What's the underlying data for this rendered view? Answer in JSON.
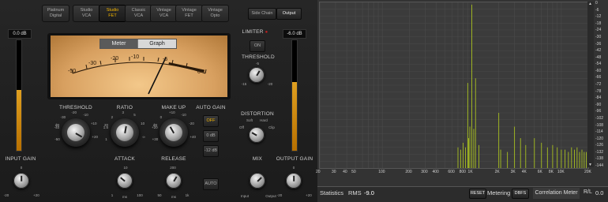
{
  "presets": [
    {
      "label": "Platinum\nDigital",
      "active": false
    },
    {
      "label": "Studio\nVCA",
      "active": false
    },
    {
      "label": "Studio\nFET",
      "active": true
    },
    {
      "label": "Classic\nVCA",
      "active": false
    },
    {
      "label": "Vintage\nVCA",
      "active": false
    },
    {
      "label": "Vintage\nFET",
      "active": false
    },
    {
      "label": "Vintage\nOpto",
      "active": false
    }
  ],
  "tabs": {
    "side_chain": "Side Chain",
    "output": "Output"
  },
  "input_meter": {
    "readout": "0.0 dB",
    "level": 0.55
  },
  "output_meter": {
    "readout": "-6.0 dB",
    "level": 0.62
  },
  "meter": {
    "tab_meter": "Meter",
    "tab_graph": "Graph",
    "scale": [
      "-50",
      "-30",
      "-20",
      "-10",
      "-5",
      "0"
    ]
  },
  "labels": {
    "threshold": "THRESHOLD",
    "ratio": "RATIO",
    "make_up": "MAKE UP",
    "auto_gain": "AUTO GAIN",
    "input_gain": "INPUT GAIN",
    "attack": "ATTACK",
    "release": "RELEASE",
    "limiter": "LIMITER",
    "limiter_threshold": "THRESHOLD",
    "distortion": "DISTORTION",
    "mix": "MIX",
    "output_gain": "OUTPUT GAIN",
    "soft": "Soft",
    "hard": "Hard",
    "off": "Off",
    "clip": "Clip",
    "input": "Input",
    "output": "Output",
    "db": "dB",
    "ms": "ms"
  },
  "buttons": {
    "auto_gain_off": "OFF",
    "auto_gain_0db": "0 dB",
    "auto_gain_m12db": "-12 dB",
    "auto": "AUTO",
    "limiter_on": "ON"
  },
  "scales": {
    "threshold": [
      "-30",
      "-20",
      "-10",
      "-40",
      "+10",
      "-50",
      "dB",
      "+20"
    ],
    "ratio": [
      "2",
      "3",
      "5",
      "1.5",
      "10",
      "1",
      "20",
      "∞"
    ],
    "make_up": [
      "0",
      "+10",
      "-10",
      "+20",
      "-20",
      "+30",
      "dB",
      "+40"
    ],
    "attack": [
      "1",
      "3",
      "10",
      "30",
      "100"
    ],
    "release": [
      "50",
      "100",
      "200",
      "500",
      "1k"
    ],
    "limiter_threshold": [
      "-10",
      "-5",
      "0",
      "-15",
      "-20"
    ],
    "input_gain": [
      "-10",
      "0",
      "+10",
      "-20",
      "+20"
    ],
    "output_gain": [
      "-10",
      "0",
      "+10",
      "-20",
      "+20"
    ]
  },
  "analyzer": {
    "y_labels": [
      "0",
      "-6",
      "-12",
      "-18",
      "-24",
      "-30",
      "-36",
      "-42",
      "-48",
      "-54",
      "-60",
      "-66",
      "-72",
      "-78",
      "-84",
      "-90",
      "-96",
      "-102",
      "-108",
      "-114",
      "-120",
      "-126",
      "-132",
      "-138",
      "-144"
    ],
    "x_labels": [
      "20",
      "30",
      "40",
      "50",
      "100",
      "200",
      "300",
      "400",
      "600",
      "800",
      "1K",
      "2K",
      "3K",
      "4K",
      "6K",
      "8K",
      "10K",
      "20K"
    ],
    "statistics": "Statistics",
    "rms_label": "RMS",
    "rms_value": "-9.0",
    "reset": "RESET",
    "metering": "Metering",
    "dbfs": "DBFS",
    "correlation": "Correlation Meter",
    "rl": "R/L",
    "corr_value": "0.0"
  }
}
